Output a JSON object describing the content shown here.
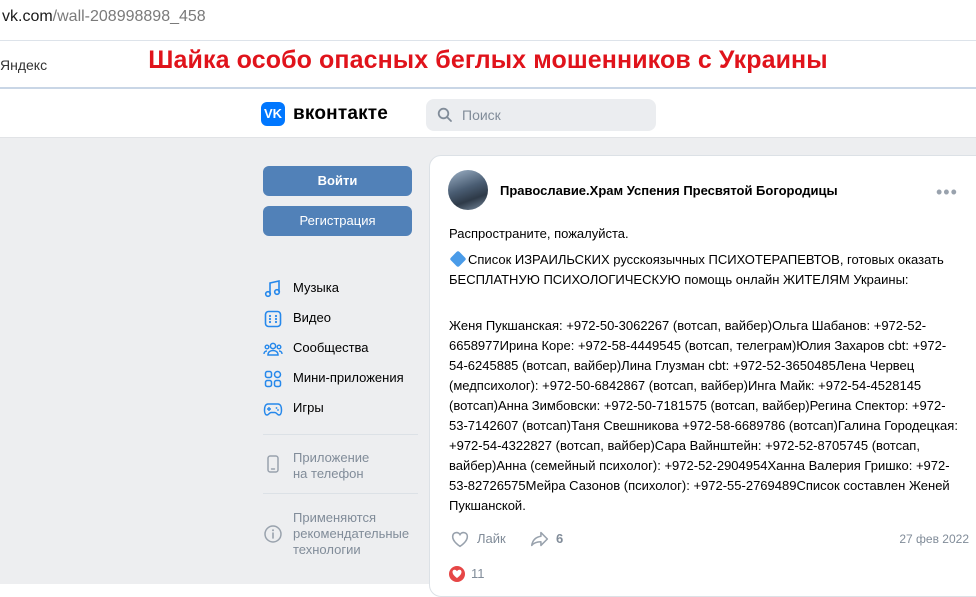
{
  "browser": {
    "url_host": "vk.com",
    "url_path": "/wall-208998898_458",
    "bookmark": "Яндекс"
  },
  "overlay_title": "Шайка особо опасных беглых мошенников с Украины",
  "header": {
    "brand": "вконтакте",
    "search_placeholder": "Поиск"
  },
  "sidebar": {
    "login_button": "Войти",
    "register_button": "Регистрация",
    "items": [
      {
        "label": "Музыка",
        "icon": "music-icon"
      },
      {
        "label": "Видео",
        "icon": "video-icon"
      },
      {
        "label": "Сообщества",
        "icon": "communities-icon"
      },
      {
        "label": "Мини-приложения",
        "icon": "mini-apps-icon"
      },
      {
        "label": "Игры",
        "icon": "games-icon"
      }
    ],
    "app_line1": "Приложение",
    "app_line2": "на телефон",
    "rec_line1": "Применяются",
    "rec_line2": "рекомендательные",
    "rec_line3": "технологии"
  },
  "post": {
    "author": "Православие.Храм Успения Пресвятой Богородицы",
    "line1": "Распространите, пожалуйста.",
    "line2": "Список ИЗРАИЛЬСКИХ русскоязычных ПСИХОТЕРАПЕВТОВ, готовых оказать БЕСПЛАТНУЮ ПСИХОЛОГИЧЕСКУЮ помощь онлайн ЖИТЕЛЯМ Украины:",
    "body": "Женя Пукшанская: +972-50-3062267 (вотсап, вайбер)Ольга Шабанов: +972-52-6658977Ирина Коре: +972-58-4449545 (вотсап, телеграм)Юлия Захаров cbt: +972-54-6245885 (вотсап, вайбер)Лина Глузман cbt: +972-52-3650485Лена Червец (медпсихолог): +972-50-6842867 (вотсап, вайбер)Инга Майк: +972-54-4528145 (вотсап)Анна Зимбовски: +972-50-7181575 (вотсап, вайбер)Регина Спектор: +972-53-7142607 (вотсап)Таня Свешникова +972-58-6689786 (вотсап)Галина Городецкая: +972-54-4322827 (вотсап, вайбер)Сара Вайнштейн: +972-52-8705745 (вотсап, вайбер)Анна (семейный психолог): +972-52-2904954Ханна Валерия Гришко: +972-53-82726575Мейра Сазонов (психолог): +972-55-2769489Список составлен Женей Пукшанской.",
    "like_label": "Лайк",
    "share_count": "6",
    "date": "27 фев 2022",
    "reactions_count": "11"
  },
  "colors": {
    "overlay_title": "#e0131b",
    "vk_blue": "#0077ff",
    "button": "#5181b8",
    "page_bg": "#edeef0"
  }
}
